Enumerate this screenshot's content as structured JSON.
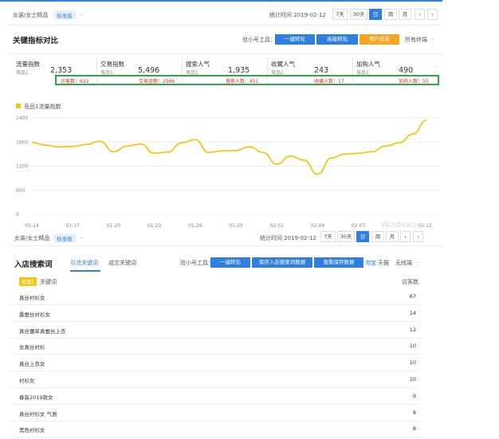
{
  "header1": {
    "breadcrumb": "女装/女士精品",
    "badge": "标准版",
    "stat_time": "统计时间 2019-02-12",
    "ranges": [
      "7天",
      "30天",
      "日",
      "周",
      "月"
    ],
    "active_range": "日",
    "prev": "‹",
    "next": "›"
  },
  "metrics_section": {
    "title": "关键指标对比",
    "tool_label": "验小号工具：",
    "btn1": "一键转化",
    "btn2": "高级转化",
    "btn3": "用户信息",
    "terminal": "所有终端",
    "cards": [
      {
        "label": "流量指数",
        "sub": "竞品1",
        "value": "2,353",
        "note": "访客数：622"
      },
      {
        "label": "交易指数",
        "sub": "竞品1",
        "value": "5,496",
        "note": "交易金额：2566"
      },
      {
        "label": "搜索人气",
        "sub": "竞品1",
        "value": "1,935",
        "note": "搜索人数：451"
      },
      {
        "label": "收藏人气",
        "sub": "竞品1",
        "value": "243",
        "note": "收藏人数：17"
      },
      {
        "label": "加购人气",
        "sub": "竞品1",
        "value": "490",
        "note": "加购人数：50"
      }
    ]
  },
  "chart_data": {
    "type": "line",
    "legend": "竞品1流量指数",
    "legend_position": "top-left",
    "x": [
      "01-14",
      "01-15",
      "01-16",
      "01-17",
      "01-18",
      "01-19",
      "01-20",
      "01-21",
      "01-22",
      "01-23",
      "01-24",
      "01-25",
      "01-26",
      "01-27",
      "01-28",
      "01-29",
      "01-30",
      "01-31",
      "02-01",
      "02-02",
      "02-03",
      "02-04",
      "02-05",
      "02-06",
      "02-07",
      "02-08",
      "02-09",
      "02-10",
      "02-11",
      "02-12"
    ],
    "x_tick_labels": [
      "01-14",
      "01-17",
      "01-20",
      "01-23",
      "01-26",
      "01-29",
      "02-01",
      "02-04",
      "02-07",
      "02-12"
    ],
    "series": [
      {
        "name": "竞品1流量指数",
        "color": "#f5c518",
        "values": [
          1790,
          1720,
          1680,
          1690,
          1740,
          1820,
          1560,
          1700,
          1750,
          1520,
          1550,
          1780,
          1860,
          1540,
          1580,
          1590,
          1680,
          1540,
          1250,
          1450,
          1350,
          1000,
          1400,
          1500,
          1520,
          1560,
          1700,
          1780,
          2000,
          2340
        ]
      }
    ],
    "y_ticks": [
      0,
      600,
      1200,
      1800,
      2400
    ],
    "ylim": [
      0,
      2400
    ],
    "grid": true,
    "watermark": "Windows"
  },
  "header2": {
    "breadcrumb": "女装/女士精品",
    "badge": "标准版",
    "stat_time": "统计时间 2019-02-12",
    "ranges": [
      "7天",
      "30天",
      "日",
      "周",
      "月"
    ],
    "active_range": "日",
    "prev": "‹",
    "next": "›"
  },
  "keywords_section": {
    "title": "入店搜索词",
    "tabs": [
      "引流关键词",
      "成交关键词"
    ],
    "active_tab": "引流关键词",
    "tool_label": "验小号工具：",
    "btn1": "一键转化",
    "btn2": "保存入店搜索词数据",
    "btn3": "查看保存数据",
    "platform": "淘宝",
    "platform2": "天猫",
    "terminal": "无线端",
    "tag": "竞品1",
    "col_keyword": "关键词",
    "col_count": "访客数",
    "rows": [
      {
        "keyword": "真丝衬衫女",
        "count": "67"
      },
      {
        "keyword": "桑蚕丝衬衫女",
        "count": "14"
      },
      {
        "keyword": "真丝蕾单真蚕丝上衣",
        "count": "12"
      },
      {
        "keyword": "女真丝衬衫",
        "count": "10"
      },
      {
        "keyword": "真丝上衣女",
        "count": "10"
      },
      {
        "keyword": "衬衫女",
        "count": "10"
      },
      {
        "keyword": "春装2019款女",
        "count": "9"
      },
      {
        "keyword": "真丝衬衫女 气质",
        "count": "8"
      },
      {
        "keyword": "黑色衬衫女",
        "count": "8"
      }
    ]
  }
}
